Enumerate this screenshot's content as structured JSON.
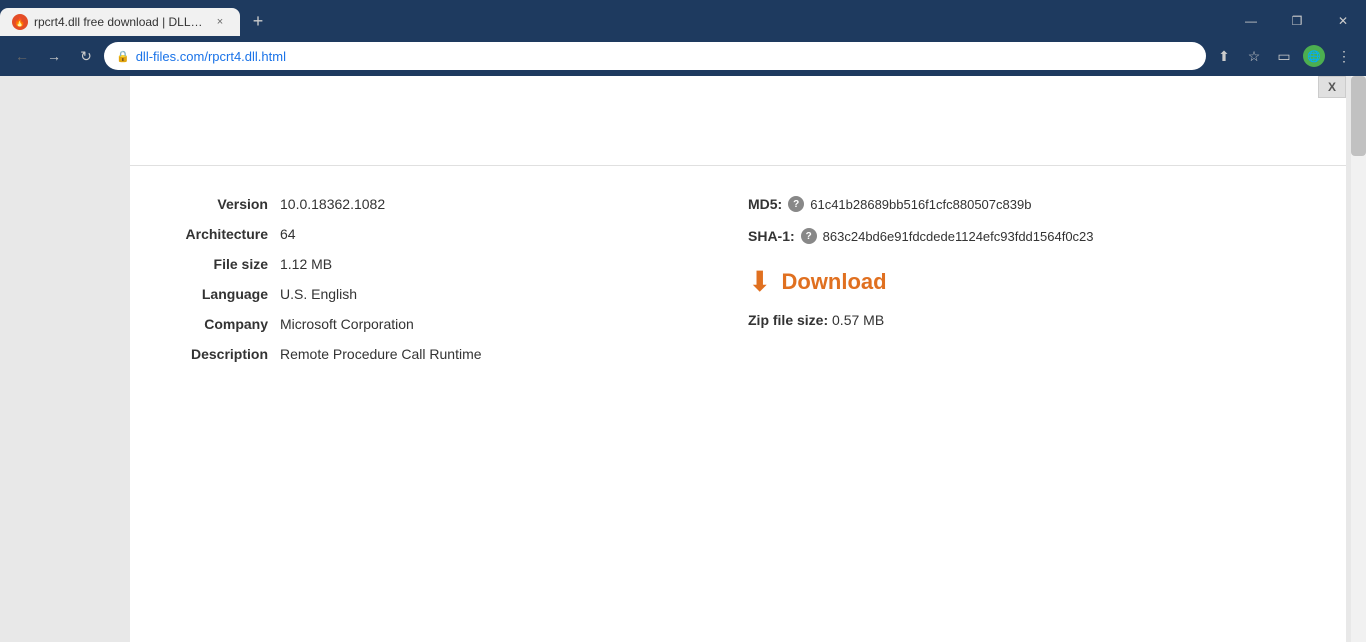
{
  "browser": {
    "tab": {
      "favicon": "🔥",
      "title": "rpcrt4.dll free download | DLL-fi...",
      "close_label": "×"
    },
    "new_tab_label": "+",
    "window_controls": {
      "minimize": "—",
      "maximize": "❒",
      "close": "✕"
    },
    "nav": {
      "back": "←",
      "forward": "→",
      "reload": "↻"
    },
    "url": {
      "lock_icon": "🔒",
      "address": "dll-files.com/rpcrt4.dll.html"
    },
    "toolbar": {
      "share": "⬆",
      "bookmark": "☆",
      "sidebar": "▭",
      "profile": "🌐",
      "menu": "⋮"
    }
  },
  "content": {
    "close_btn": "X",
    "banner": "",
    "file_details": {
      "version_label": "Version",
      "version_value": "10.0.18362.1082",
      "architecture_label": "Architecture",
      "architecture_value": "64",
      "file_size_label": "File size",
      "file_size_value": "1.12 MB",
      "language_label": "Language",
      "language_value": "U.S. English",
      "company_label": "Company",
      "company_value": "Microsoft Corporation",
      "description_label": "Description",
      "description_value": "Remote Procedure Call Runtime"
    },
    "hashes": {
      "md5_label": "MD5:",
      "md5_value": "61c41b28689bb516f1cfc880507c839b",
      "sha1_label": "SHA-1:",
      "sha1_value": "863c24bd6e91fdcdede1124efc93fdd1564f0c23"
    },
    "download": {
      "label": "Download",
      "zip_size_label": "Zip file size:",
      "zip_size_value": "0.57 MB"
    }
  }
}
